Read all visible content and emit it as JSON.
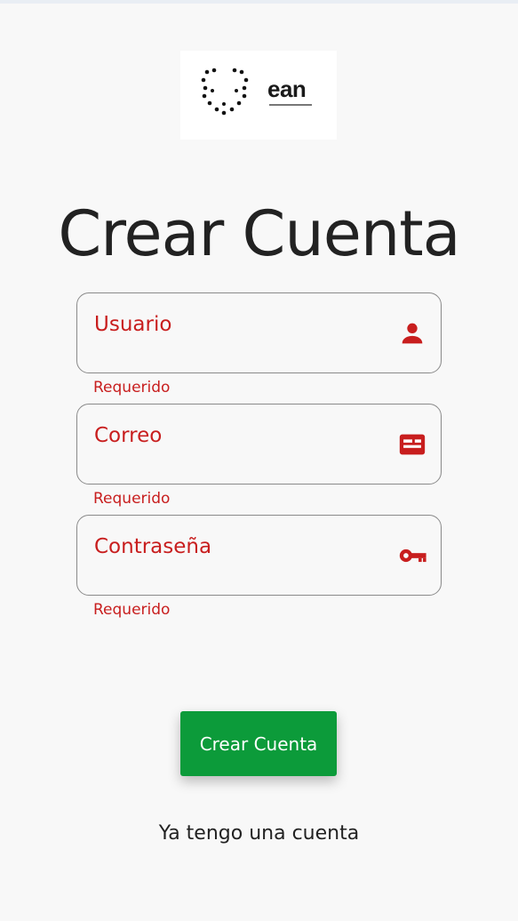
{
  "logo": {
    "word": "ean",
    "icon": "ean-logo"
  },
  "title": "Crear Cuenta",
  "fields": [
    {
      "label": "Usuario",
      "value": "",
      "helper": "Requerido",
      "icon": "person-icon"
    },
    {
      "label": "Correo",
      "value": "",
      "helper": "Requerido",
      "icon": "email-card-icon"
    },
    {
      "label": "Contraseña",
      "value": "",
      "helper": "Requerido",
      "icon": "key-icon"
    }
  ],
  "submit_label": "Crear Cuenta",
  "login_link": "Ya tengo una cuenta",
  "colors": {
    "error": "#c81e1e",
    "primary": "#0c9b3a",
    "background": "#f8f8f8"
  }
}
